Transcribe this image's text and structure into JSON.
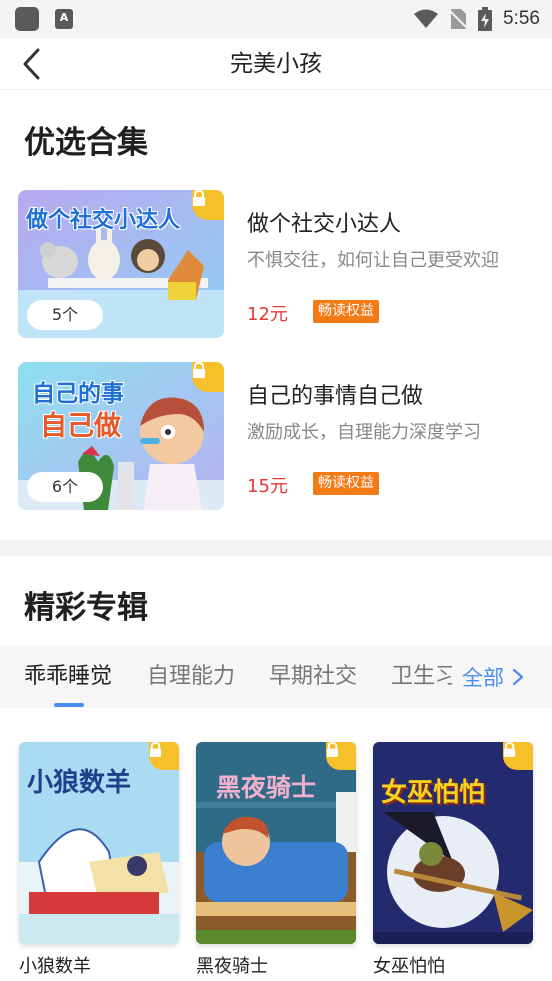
{
  "status_bar": {
    "time": "5:56",
    "app_icon_letter": "A"
  },
  "nav": {
    "title": "完美小孩",
    "back_icon": "chevron-left-icon"
  },
  "featured": {
    "heading": "优选合集",
    "items": [
      {
        "cover_text": "做个社交小达人",
        "title": "做个社交小达人",
        "desc": "不惧交往，如何让自己更受欢迎",
        "count": "5个",
        "price": "12元",
        "badge": "畅读权益",
        "locked": true
      },
      {
        "cover_text_line1": "自己的事",
        "cover_text_line2": "自己做",
        "title": "自己的事情自己做",
        "desc": "激励成长，自理能力深度学习",
        "count": "6个",
        "price": "15元",
        "badge": "畅读权益",
        "locked": true
      }
    ]
  },
  "albums_section": {
    "heading": "精彩专辑",
    "tabs": [
      "乖乖睡觉",
      "自理能力",
      "早期社交",
      "卫生习"
    ],
    "active_tab": 0,
    "all_label": "全部",
    "items": [
      {
        "cover_text": "小狼数羊",
        "name": "小狼数羊",
        "locked": true
      },
      {
        "cover_text": "黑夜骑士",
        "name": "黑夜骑士",
        "locked": true
      },
      {
        "cover_text": "女巫怕怕",
        "name": "女巫怕怕",
        "locked": true
      }
    ]
  },
  "colors": {
    "price_red": "#e53935",
    "badge_orange": "#f47a16",
    "accent_blue": "#4a8cf0",
    "lock_yellow": "#f6c02a"
  }
}
